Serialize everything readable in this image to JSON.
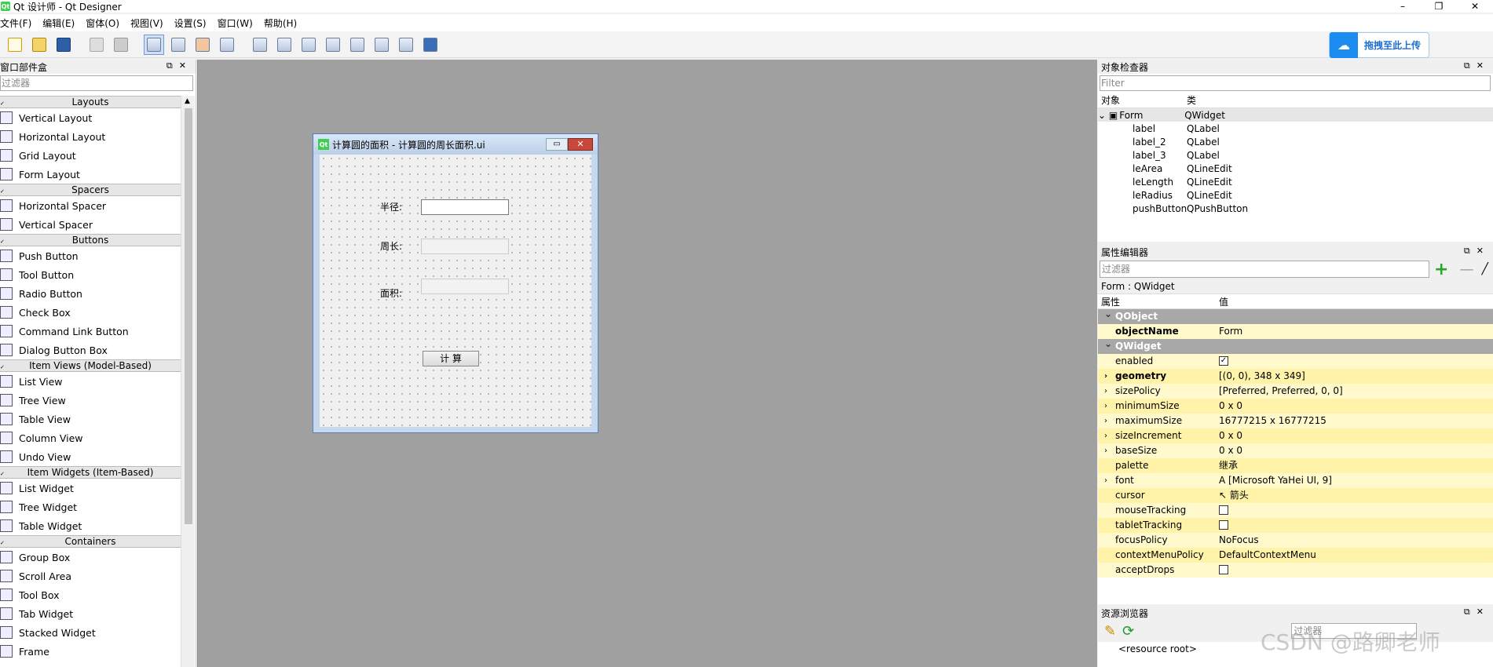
{
  "app": {
    "title": "Qt 设计师 - Qt Designer",
    "logo_text": "Qt"
  },
  "window_controls": {
    "minimize": "–",
    "restore": "❐",
    "close": "✕"
  },
  "menu": [
    "文件(F)",
    "编辑(E)",
    "窗体(O)",
    "视图(V)",
    "设置(S)",
    "窗口(W)",
    "帮助(H)"
  ],
  "upload": {
    "label": "拖拽至此上传"
  },
  "widget_box": {
    "title": "窗口部件盒",
    "filter_placeholder": "过滤器",
    "categories": [
      {
        "name": "Layouts",
        "items": [
          "Vertical Layout",
          "Horizontal Layout",
          "Grid Layout",
          "Form Layout"
        ]
      },
      {
        "name": "Spacers",
        "items": [
          "Horizontal Spacer",
          "Vertical Spacer"
        ]
      },
      {
        "name": "Buttons",
        "items": [
          "Push Button",
          "Tool Button",
          "Radio Button",
          "Check Box",
          "Command Link Button",
          "Dialog Button Box"
        ]
      },
      {
        "name": "Item Views (Model-Based)",
        "items": [
          "List View",
          "Tree View",
          "Table View",
          "Column View",
          "Undo View"
        ]
      },
      {
        "name": "Item Widgets (Item-Based)",
        "items": [
          "List Widget",
          "Tree Widget",
          "Table Widget"
        ]
      },
      {
        "name": "Containers",
        "items": [
          "Group Box",
          "Scroll Area",
          "Tool Box",
          "Tab Widget",
          "Stacked Widget",
          "Frame"
        ]
      }
    ]
  },
  "form": {
    "title": "计算圆的面积 - 计算圆的周长面积.ui",
    "labels": {
      "radius": "半径:",
      "perimeter": "周长:",
      "area": "面积:"
    },
    "button": "计 算"
  },
  "object_inspector": {
    "title": "对象检查器",
    "filter_placeholder": "Filter",
    "col_object": "对象",
    "col_class": "类",
    "rows": [
      {
        "name": "Form",
        "cls": "QWidget"
      },
      {
        "name": "label",
        "cls": "QLabel"
      },
      {
        "name": "label_2",
        "cls": "QLabel"
      },
      {
        "name": "label_3",
        "cls": "QLabel"
      },
      {
        "name": "leArea",
        "cls": "QLineEdit"
      },
      {
        "name": "leLength",
        "cls": "QLineEdit"
      },
      {
        "name": "leRadius",
        "cls": "QLineEdit"
      },
      {
        "name": "pushButton",
        "cls": "QPushButton"
      }
    ]
  },
  "property_editor": {
    "title": "属性编辑器",
    "filter_placeholder": "过滤器",
    "subtitle": "Form : QWidget",
    "col_prop": "属性",
    "col_value": "值",
    "group_qobject": "QObject",
    "group_qwidget": "QWidget",
    "objectName": {
      "name": "objectName",
      "value": "Form"
    },
    "props": [
      {
        "name": "enabled",
        "value": "✓",
        "kind": "check"
      },
      {
        "name": "geometry",
        "value": "[(0, 0), 348 x 349]",
        "bold": true,
        "exp": true
      },
      {
        "name": "sizePolicy",
        "value": "[Preferred, Preferred, 0, 0]",
        "exp": true
      },
      {
        "name": "minimumSize",
        "value": "0 x 0",
        "exp": true
      },
      {
        "name": "maximumSize",
        "value": "16777215 x 16777215",
        "exp": true
      },
      {
        "name": "sizeIncrement",
        "value": "0 x 0",
        "exp": true
      },
      {
        "name": "baseSize",
        "value": "0 x 0",
        "exp": true
      },
      {
        "name": "palette",
        "value": "继承"
      },
      {
        "name": "font",
        "value": "A  [Microsoft YaHei UI, 9]",
        "exp": true
      },
      {
        "name": "cursor",
        "value": "↖  箭头"
      },
      {
        "name": "mouseTracking",
        "value": "",
        "kind": "check"
      },
      {
        "name": "tabletTracking",
        "value": "",
        "kind": "check"
      },
      {
        "name": "focusPolicy",
        "value": "NoFocus"
      },
      {
        "name": "contextMenuPolicy",
        "value": "DefaultContextMenu"
      },
      {
        "name": "acceptDrops",
        "value": "",
        "kind": "check"
      }
    ]
  },
  "resource_browser": {
    "title": "资源浏览器",
    "filter_placeholder": "过滤器",
    "root": "<resource root>"
  },
  "watermark": "CSDN @路卿老师"
}
